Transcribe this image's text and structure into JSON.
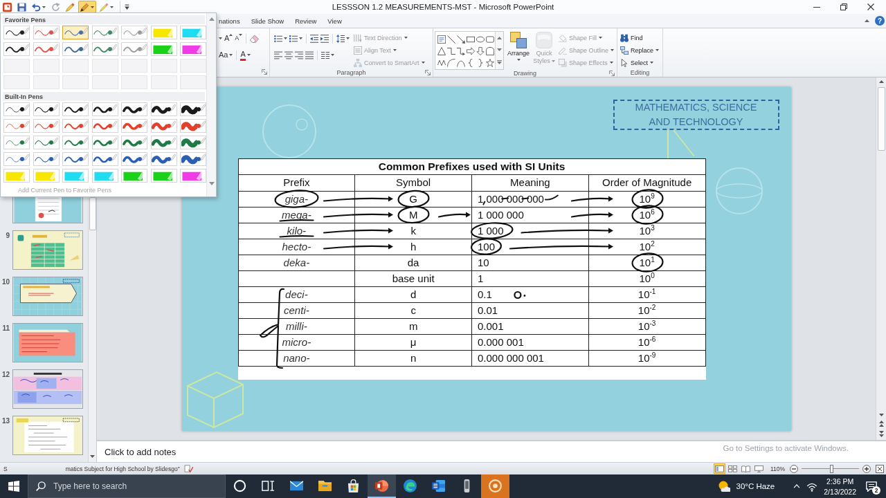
{
  "window": {
    "title": "LESSSON 1.2 MEASUREMENTS-MST - Microsoft PowerPoint"
  },
  "quick_access": [
    {
      "kind": "app",
      "menu": false,
      "selected": false
    },
    {
      "kind": "save",
      "menu": false,
      "selected": false
    },
    {
      "kind": "undo",
      "menu": true,
      "selected": false
    },
    {
      "kind": "redo",
      "menu": false,
      "selected": false
    },
    {
      "kind": "brush",
      "menu": false,
      "selected": false
    },
    {
      "kind": "pen",
      "menu": true,
      "selected": true
    },
    {
      "kind": "highlighter",
      "menu": true,
      "selected": false
    },
    {
      "kind": "customize",
      "menu": false,
      "selected": false
    }
  ],
  "ribbon": {
    "tabs": [
      {
        "label": "nations",
        "selected": false
      },
      {
        "label": "Slide Show",
        "selected": false
      },
      {
        "label": "Review",
        "selected": false
      },
      {
        "label": "View",
        "selected": false
      }
    ],
    "help": "?",
    "font_group": {
      "row_1": [
        {
          "kind": "size-menu"
        },
        {
          "kind": "grow",
          "label": "A"
        },
        {
          "kind": "shrink",
          "label": "A"
        },
        {
          "kind": "clear"
        }
      ],
      "row_2": [
        {
          "kind": "case",
          "label": "Aa"
        },
        {
          "kind": "font-color",
          "label": "A"
        }
      ]
    },
    "paragraph_group": {
      "label": "Paragraph",
      "row_1": [
        {
          "kind": "bullets",
          "menu": true
        },
        {
          "kind": "numbering",
          "menu": true
        },
        {
          "kind": "outdent",
          "menu": false
        },
        {
          "kind": "indent",
          "menu": false
        },
        {
          "kind": "line-spacing",
          "menu": true
        }
      ],
      "row_2": [
        {
          "kind": "align-left",
          "menu": false
        },
        {
          "kind": "center",
          "menu": false
        },
        {
          "kind": "align-right",
          "menu": false
        },
        {
          "kind": "justify",
          "menu": false
        },
        {
          "kind": "columns",
          "menu": true
        }
      ],
      "commands": [
        {
          "kind": "text-direction",
          "label": "Text Direction",
          "menu": true,
          "disabled": true
        },
        {
          "kind": "align-text",
          "label": "Align Text",
          "menu": true,
          "disabled": true
        },
        {
          "kind": "smartart",
          "label": "Convert to SmartArt",
          "menu": true,
          "disabled": true
        }
      ]
    },
    "drawing_group": {
      "label": "Drawing",
      "shapes": [
        {
          "kind": "text-box"
        },
        {
          "kind": "line"
        },
        {
          "kind": "arrow"
        },
        {
          "kind": "rectangle"
        },
        {
          "kind": "oval"
        },
        {
          "kind": "rounded-rectangle"
        },
        {
          "kind": "triangle"
        },
        {
          "kind": "elbow-connector"
        },
        {
          "kind": "elbow-arrow"
        },
        {
          "kind": "right-arrow"
        },
        {
          "kind": "down-arrow"
        },
        {
          "kind": "arch"
        },
        {
          "kind": "freeform"
        },
        {
          "kind": "arc"
        },
        {
          "kind": "curve"
        },
        {
          "kind": "left-brace"
        },
        {
          "kind": "right-brace"
        },
        {
          "kind": "star"
        }
      ],
      "arrange": {
        "label": "Arrange",
        "menu": true,
        "disabled": false
      },
      "quick_styles": {
        "label": "Quick Styles",
        "menu": true,
        "disabled": true
      },
      "commands": [
        {
          "kind": "fill",
          "label": "Shape Fill",
          "menu": true,
          "disabled": true
        },
        {
          "kind": "outline",
          "label": "Shape Outline",
          "menu": true,
          "disabled": true
        },
        {
          "kind": "effects",
          "label": "Shape Effects",
          "menu": true,
          "disabled": true
        }
      ]
    },
    "editing_group": {
      "label": "Editing",
      "commands": [
        {
          "kind": "find",
          "label": "Find",
          "menu": false,
          "disabled": false
        },
        {
          "kind": "replace",
          "label": "Replace",
          "menu": true,
          "disabled": false
        },
        {
          "kind": "select",
          "label": "Select",
          "menu": true,
          "disabled": false
        }
      ]
    }
  },
  "pens": {
    "favorites_title": "Favorite Pens",
    "favorites": [
      {
        "kind": "extra-fine",
        "color": "#222222",
        "selected": false
      },
      {
        "kind": "extra-fine",
        "color": "#d9534f",
        "selected": false
      },
      {
        "kind": "extra-fine",
        "color": "#4a6fae",
        "selected": true
      },
      {
        "kind": "extra-fine",
        "color": "#3d8a62",
        "selected": false
      },
      {
        "kind": "extra-fine",
        "color": "#9a9a9a",
        "selected": false
      },
      {
        "kind": "highlighter",
        "color": "#f7e600",
        "selected": false
      },
      {
        "kind": "highlighter",
        "color": "#1fdcf2",
        "selected": false
      },
      {
        "kind": "fine",
        "color": "#222222",
        "selected": false
      },
      {
        "kind": "fine",
        "color": "#d9534f",
        "selected": false
      },
      {
        "kind": "fine",
        "color": "#3f6896",
        "selected": false
      },
      {
        "kind": "fine",
        "color": "#3d8a62",
        "selected": false
      },
      {
        "kind": "fine",
        "color": "#9a9a9a",
        "selected": false
      },
      {
        "kind": "highlighter",
        "color": "#19d219",
        "selected": false
      },
      {
        "kind": "highlighter",
        "color": "#f03ce6",
        "selected": false
      },
      {
        "kind": "empty",
        "selected": false
      },
      {
        "kind": "empty",
        "selected": false
      },
      {
        "kind": "empty",
        "selected": false
      },
      {
        "kind": "empty",
        "selected": false
      },
      {
        "kind": "empty",
        "selected": false
      },
      {
        "kind": "empty",
        "selected": false
      },
      {
        "kind": "empty",
        "selected": false
      },
      {
        "kind": "empty",
        "selected": false
      },
      {
        "kind": "empty",
        "selected": false
      },
      {
        "kind": "empty",
        "selected": false
      },
      {
        "kind": "empty",
        "selected": false
      },
      {
        "kind": "empty",
        "selected": false
      },
      {
        "kind": "empty",
        "selected": false
      },
      {
        "kind": "empty",
        "selected": false
      }
    ],
    "built_in_title": "Built-In Pens",
    "built_in": [
      {
        "kind": "hairline",
        "color": "#1a1a1a",
        "selected": false
      },
      {
        "kind": "extra-fine",
        "color": "#1a1a1a",
        "selected": false
      },
      {
        "kind": "fine",
        "color": "#1a1a1a",
        "selected": false
      },
      {
        "kind": "medium",
        "color": "#1a1a1a",
        "selected": false
      },
      {
        "kind": "bold",
        "color": "#1a1a1a",
        "selected": false
      },
      {
        "kind": "extra-bold",
        "color": "#1a1a1a",
        "selected": false
      },
      {
        "kind": "broad",
        "color": "#1a1a1a",
        "selected": false
      },
      {
        "kind": "hairline",
        "color": "#e2402b",
        "selected": false
      },
      {
        "kind": "extra-fine",
        "color": "#e2402b",
        "selected": false
      },
      {
        "kind": "fine",
        "color": "#e2402b",
        "selected": false
      },
      {
        "kind": "medium",
        "color": "#e2402b",
        "selected": false
      },
      {
        "kind": "bold",
        "color": "#e2402b",
        "selected": false
      },
      {
        "kind": "extra-bold",
        "color": "#e2402b",
        "selected": false
      },
      {
        "kind": "broad",
        "color": "#e2402b",
        "selected": false
      },
      {
        "kind": "hairline",
        "color": "#1f7a45",
        "selected": false
      },
      {
        "kind": "extra-fine",
        "color": "#1f7a45",
        "selected": false
      },
      {
        "kind": "fine",
        "color": "#1f7a45",
        "selected": false
      },
      {
        "kind": "medium",
        "color": "#1f7a45",
        "selected": false
      },
      {
        "kind": "bold",
        "color": "#1f7a45",
        "selected": false
      },
      {
        "kind": "extra-bold",
        "color": "#1f7a45",
        "selected": false
      },
      {
        "kind": "broad",
        "color": "#1f7a45",
        "selected": false
      },
      {
        "kind": "hairline",
        "color": "#2c5fb3",
        "selected": false
      },
      {
        "kind": "extra-fine",
        "color": "#2c5fb3",
        "selected": false
      },
      {
        "kind": "fine",
        "color": "#2c5fb3",
        "selected": false
      },
      {
        "kind": "medium",
        "color": "#2c5fb3",
        "selected": false
      },
      {
        "kind": "bold",
        "color": "#2c5fb3",
        "selected": false
      },
      {
        "kind": "extra-bold",
        "color": "#2c5fb3",
        "selected": false
      },
      {
        "kind": "broad",
        "color": "#2c5fb3",
        "selected": false
      },
      {
        "kind": "highlighter",
        "color": "#f7e600",
        "selected": false
      },
      {
        "kind": "highlighter",
        "color": "#f7e600",
        "selected": false
      },
      {
        "kind": "highlighter",
        "color": "#1fdcf2",
        "selected": false
      },
      {
        "kind": "highlighter",
        "color": "#1fdcf2",
        "selected": false
      },
      {
        "kind": "highlighter",
        "color": "#19d219",
        "selected": false
      },
      {
        "kind": "highlighter",
        "color": "#19d219",
        "selected": false
      },
      {
        "kind": "highlighter",
        "color": "#f03ce6",
        "selected": false
      }
    ],
    "add_favorite": {
      "label": "Add Current Pen to Favorite Pens",
      "disabled": true
    }
  },
  "slide_thumbnails": [
    {
      "kind": "table-document",
      "cut": true
    },
    {
      "number": "9",
      "kind": "derived-units",
      "cut": false
    },
    {
      "number": "10",
      "kind": "arrow-banner",
      "cut": false
    },
    {
      "number": "11",
      "kind": "note-box",
      "cut": false
    },
    {
      "number": "12",
      "kind": "chart",
      "cut": false
    },
    {
      "number": "13",
      "kind": "example",
      "cut": false
    }
  ],
  "slide": {
    "badge": "MATHEMATICS, SCIENCE AND TECHNOLOGY",
    "table": {
      "title": "Common Prefixes used with SI Units",
      "columns": [
        "Prefix",
        "Symbol",
        "Meaning",
        "Order of Magnitude"
      ],
      "rows": [
        {
          "prefix": "giga-",
          "symbol": "G",
          "meaning": "1 000 000 000",
          "magnitude": "10$^{9}$",
          "ink": {
            "prefix_circled": true,
            "symbol_circled": true,
            "magnitude_circled": true,
            "prefix_arrow": true,
            "meaning_arrow": true,
            "meaning_scribbled": true
          }
        },
        {
          "prefix": "mega-",
          "symbol": "M",
          "meaning": "1 000 000",
          "magnitude": "10$^{6}$",
          "ink": {
            "symbol_circled": true,
            "magnitude_circled": true,
            "prefix_underlined": true,
            "prefix_arrow": true,
            "symbol_arrow": true,
            "meaning_arrow": true
          }
        },
        {
          "prefix": "kilo-",
          "symbol": "k",
          "meaning": "1 000",
          "magnitude": "10$^{3}$",
          "ink": {
            "meaning_circled": true,
            "prefix_underlined": true,
            "prefix_arrow": true,
            "meaning_arrow": true
          }
        },
        {
          "prefix": "hecto-",
          "symbol": "h",
          "meaning": "100",
          "magnitude": "10$^{2}$",
          "ink": {
            "meaning_circled": true,
            "prefix_arrow": true,
            "meaning_arrow": true
          }
        },
        {
          "prefix": "deka-",
          "symbol": "da",
          "meaning": "10",
          "magnitude": "10$^{1}$",
          "ink": {
            "magnitude_circled": true
          }
        },
        {
          "symbol": "base unit",
          "meaning": "1",
          "magnitude": "10$^{0}$"
        },
        {
          "prefix": "deci-",
          "symbol": "d",
          "meaning": "0.1",
          "magnitude": "10$^{-1}$",
          "bracketed": true,
          "ink": {
            "meaning_dotted": true
          }
        },
        {
          "prefix": "centi-",
          "symbol": "c",
          "meaning": "0.01",
          "magnitude": "10$^{-2}$",
          "bracketed": true
        },
        {
          "prefix": "milli-",
          "symbol": "m",
          "meaning": "0.001",
          "magnitude": "10$^{-3}$",
          "bracketed": true
        },
        {
          "prefix": "micro-",
          "symbol": "μ",
          "meaning": "0.000 001",
          "magnitude": "10$^{-6}$",
          "bracketed": true
        },
        {
          "prefix": "nano-",
          "symbol": "n",
          "meaning": "0.000 000 001",
          "magnitude": "10$^{-9}$",
          "bracketed": true
        }
      ]
    }
  },
  "notes": {
    "placeholder": "Click to add notes"
  },
  "activation_notice": "Go to Settings to activate Windows.",
  "status_bar": {
    "texts": [
      "S",
      "matics Subject for High School by Slidesgo\""
    ],
    "views": [
      {
        "kind": "normal",
        "selected": true
      },
      {
        "kind": "sorter",
        "selected": false
      },
      {
        "kind": "reading",
        "selected": false
      },
      {
        "kind": "slideshow",
        "selected": false
      }
    ],
    "zoom": "110%",
    "zoom_slider": {
      "level": 0.52
    }
  },
  "taskbar": {
    "search": {
      "placeholder": "Type here to search"
    },
    "buttons": [
      {
        "kind": "cortana",
        "selected": false,
        "attention": false
      },
      {
        "kind": "task-view",
        "selected": false,
        "attention": false
      },
      {
        "kind": "mail",
        "selected": false,
        "attention": false
      },
      {
        "kind": "explorer",
        "selected": false,
        "attention": false
      },
      {
        "kind": "store",
        "selected": false,
        "attention": false
      },
      {
        "kind": "powerpoint",
        "selected": true,
        "attention": false
      },
      {
        "kind": "edge",
        "selected": false,
        "attention": false
      },
      {
        "kind": "word",
        "selected": false,
        "attention": false
      },
      {
        "kind": "device",
        "selected": false,
        "attention": false
      },
      {
        "kind": "recorder",
        "selected": false,
        "attention": true
      }
    ],
    "weather": "30°C Haze",
    "time": "2:36 PM",
    "date": "2/13/2022",
    "notifications": "2"
  }
}
